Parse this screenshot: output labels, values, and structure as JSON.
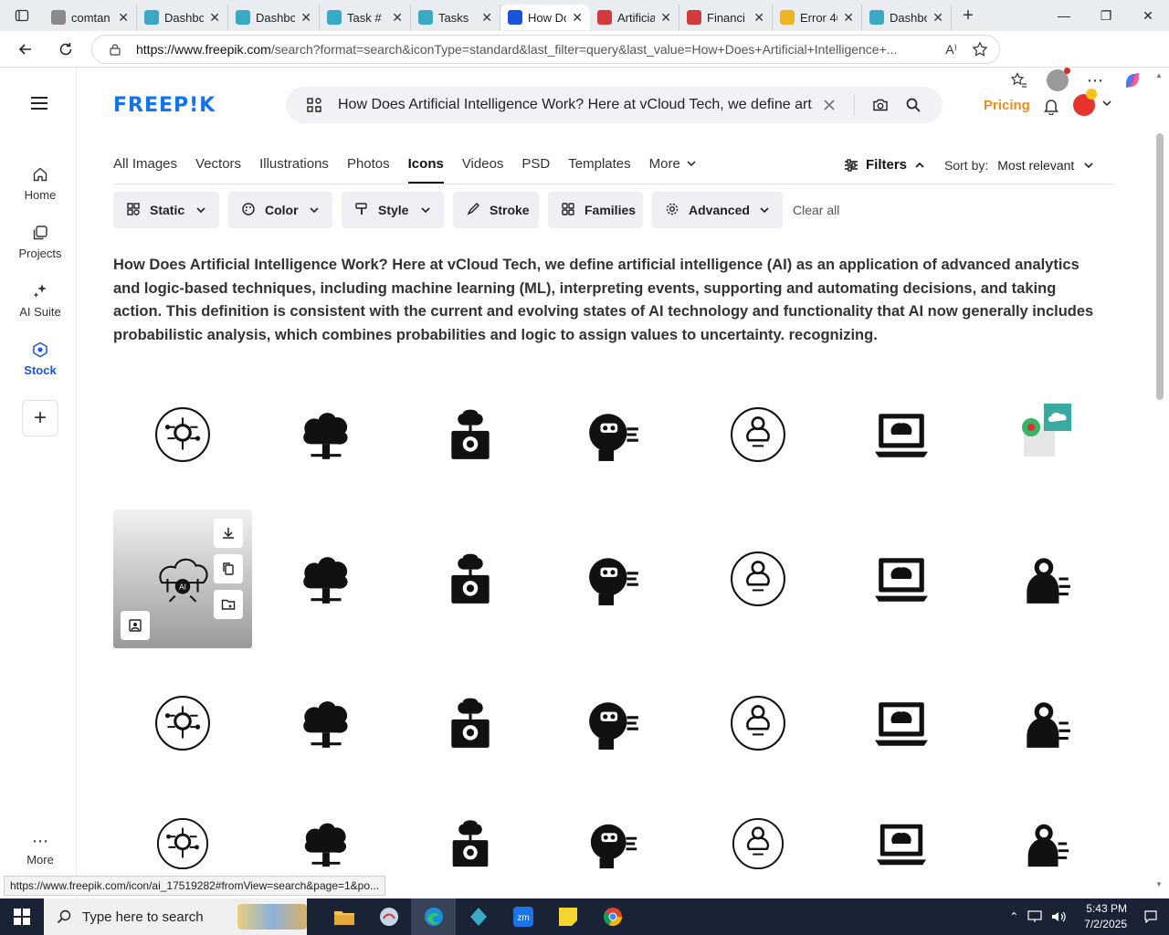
{
  "browser": {
    "tabs": [
      {
        "title": "comtan",
        "color": "#8a8a8a"
      },
      {
        "title": "Dashbo",
        "color": "#3aa9c6"
      },
      {
        "title": "Dashbo",
        "color": "#3aa9c6"
      },
      {
        "title": "Task #",
        "color": "#3aa9c6"
      },
      {
        "title": "Tasks",
        "color": "#3aa9c6"
      },
      {
        "title": "How Do",
        "color": "#1a56db",
        "active": true
      },
      {
        "title": "Artificia",
        "color": "#d33a3a"
      },
      {
        "title": "Financi",
        "color": "#d33a3a"
      },
      {
        "title": "Error 40",
        "color": "#f0b429"
      },
      {
        "title": "Dashbo",
        "color": "#3aa9c6"
      }
    ],
    "new_tab": "+",
    "url_host": "https://www.freepik.com",
    "url_rest": "/search?format=search&iconType=standard&last_filter=query&last_value=How+Does+Artificial+Intelligence+...",
    "status_url": "https://www.freepik.com/icon/ai_17519282#fromView=search&page=1&po..."
  },
  "header": {
    "logo": "FREEP!K",
    "search_query": "How Does Artificial Intelligence Work? Here at vCloud Tech, we define art",
    "pricing": "Pricing"
  },
  "sidebar": {
    "items": [
      {
        "label": "Home"
      },
      {
        "label": "Projects"
      },
      {
        "label": "AI Suite"
      },
      {
        "label": "Stock"
      }
    ],
    "more": "More"
  },
  "categories": [
    "All Images",
    "Vectors",
    "Illustrations",
    "Photos",
    "Icons",
    "Videos",
    "PSD",
    "Templates",
    "More"
  ],
  "active_category": "Icons",
  "filters": {
    "label": "Filters",
    "sort_label": "Sort by:",
    "sort_value": "Most relevant",
    "chips": [
      "Static",
      "Color",
      "Style",
      "Stroke",
      "Families",
      "Advanced"
    ],
    "clear_all": "Clear all"
  },
  "description": "How Does Artificial Intelligence Work? Here at vCloud Tech, we define artificial intelligence (AI) as an application of advanced analytics and logic-based techniques, including machine learning (ML), interpreting events, supporting and automating decisions, and taking action. This definition is consistent with the current and evolving states of AI technology and functionality that AI now generally includes probabilistic analysis, which combines probabilities and logic to assign values to uncertainty. recognizing.",
  "results": {
    "hovered_icon_label": "AI",
    "icons": [
      "ai-circle-network-icon",
      "ai-brain-tree-icon",
      "ai-robot-arm-icon",
      "ai-robot-head-icon",
      "ai-circle-head-icon",
      "ai-laptop-brain-icon",
      "ai-cloud-upload-icon",
      "ai-cloud-network-icon",
      "ai-head-gears-icon",
      "ai-cloud-gear-icon",
      "ai-cloud-chip-icon",
      "ai-user-network-icon",
      "ai-gear-network-icon",
      "ai-head-cloud-icon",
      "ai-robot-screen-icon",
      "ai-head-question-icon",
      "ai-chat-robot-icon",
      "ai-bulb-gears-icon",
      "ai-phone-chip-icon",
      "ai-laptop-brain-icon",
      "ai-hands-brain-icon",
      "ai-robot-board-icon",
      "ai-head-book-icon",
      "ai-cloud-arm-icon",
      "ai-monitor-gear-icon",
      "ai-cloud-bulb-icon",
      "ai-brain-chip-icon",
      "ai-head-chip-icon"
    ]
  },
  "taskbar": {
    "search_placeholder": "Type here to search",
    "time": "5:43 PM",
    "date": "7/2/2025"
  }
}
